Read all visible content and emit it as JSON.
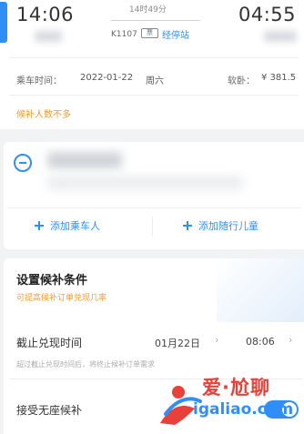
{
  "train": {
    "departure_time": "14:06",
    "arrival_time": "04:55",
    "duration": "14时49分",
    "train_number": "K1107",
    "ticket_icon": "ticket-icon",
    "stopover_text": "经停站",
    "date_label": "乘车时间：",
    "date_value": "2022-01-22",
    "weekday": "周六",
    "balance_label": "软卧：",
    "balance_value": "¥ 381.5",
    "passenger_hint": "候补人数不多"
  },
  "passenger": {
    "remove_icon": "minus-circle-icon",
    "add_passenger_label": "添加乘车人",
    "add_child_label": "添加随行儿童"
  },
  "conditions": {
    "title": "设置候补条件",
    "subtitle": "可提高候补订单兑现几率",
    "deadline_label": "截止兑现时间",
    "deadline_date": "01月22日",
    "deadline_time": "08:06",
    "deadline_hint": "超过截止兑现时间后，将终止候补订单需求",
    "no_seat_label": "接受无座候补",
    "no_seat_enabled": true
  },
  "watermark": {
    "text_cn": "爱·尬聊",
    "url": "igaliao.com"
  },
  "colors": {
    "accent": "#2f8ff7",
    "warning": "#f39a2b",
    "watermark_red": "#e8413a"
  }
}
